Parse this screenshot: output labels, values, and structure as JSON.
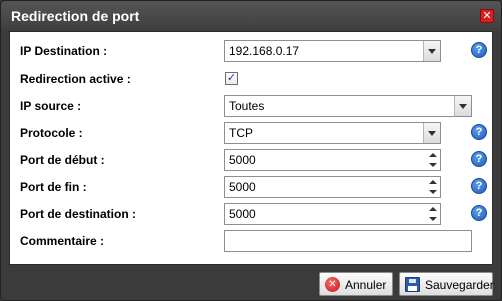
{
  "dialog": {
    "title": "Redirection de port",
    "close_glyph": "✕"
  },
  "form": {
    "ip_destination": {
      "label": "IP Destination :",
      "value": "192.168.0.17"
    },
    "redirection_active": {
      "label": "Redirection active :",
      "checked": true,
      "glyph": "✓"
    },
    "ip_source": {
      "label": "IP source :",
      "value": "Toutes"
    },
    "protocole": {
      "label": "Protocole :",
      "value": "TCP"
    },
    "port_debut": {
      "label": "Port de début :",
      "value": "5000"
    },
    "port_fin": {
      "label": "Port de fin :",
      "value": "5000"
    },
    "port_destination": {
      "label": "Port de destination :",
      "value": "5000"
    },
    "commentaire": {
      "label": "Commentaire :",
      "value": ""
    }
  },
  "help_glyph": "?",
  "buttons": {
    "cancel_label": "Annuler",
    "cancel_glyph": "✕",
    "save_label": "Sauvegarder"
  },
  "icons": {
    "help": "help-icon",
    "close": "close-icon",
    "cancel": "cancel-icon",
    "save": "floppy-disk-icon"
  },
  "colors": {
    "titlebar": "#3e3e3e",
    "help": "#1d5bbf",
    "close": "#d42020"
  }
}
